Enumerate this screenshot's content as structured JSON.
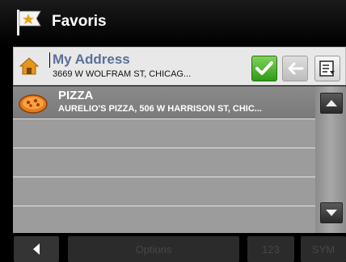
{
  "header": {
    "title": "Favoris",
    "icon": "flag-star-icon"
  },
  "address_bar": {
    "name": "My Address",
    "address": "3669 W WOLFRAM ST, CHICAG...",
    "icons": {
      "home": "home-icon",
      "confirm": "checkmark-icon",
      "back": "back-arrow-icon",
      "keyboard": "keyboard-edit-icon"
    }
  },
  "favorites": [
    {
      "name": "PIZZA",
      "detail": "AURELIO'S PIZZA, 506 W HARRISON ST, CHIC...",
      "icon": "pizza-icon",
      "selected": true
    },
    {
      "name": "",
      "detail": ""
    },
    {
      "name": "",
      "detail": ""
    },
    {
      "name": "",
      "detail": ""
    },
    {
      "name": "",
      "detail": ""
    }
  ],
  "bottom_bar": {
    "options_label": "Options",
    "numeric_label": "123",
    "symbols_label": "SYM"
  },
  "colors": {
    "accent_green": "#2e9b16",
    "list_bg": "#9c9c9c",
    "title_bg": "#000000"
  }
}
